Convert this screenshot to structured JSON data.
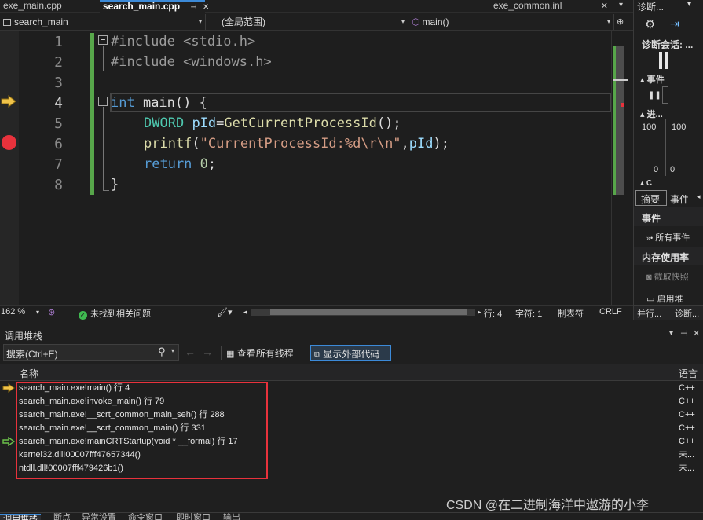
{
  "tabs": [
    {
      "label": "exe_main.cpp"
    },
    {
      "label": "search_main.cpp",
      "pin": "⊣",
      "close": "✕"
    },
    {
      "label": "exe_common.inl",
      "close": "✕"
    }
  ],
  "nav": {
    "project": "search_main",
    "scope": "(全局范围)",
    "function": "main()"
  },
  "code_lines": [
    {
      "num": "1",
      "text": "#include <stdio.h>"
    },
    {
      "num": "2",
      "text": "#include <windows.h>"
    },
    {
      "num": "3",
      "text": ""
    },
    {
      "num": "4",
      "kw": "int",
      "rest": " main() {"
    },
    {
      "num": "5",
      "ty": "DWORD",
      "var": "pId",
      "eq": "=",
      "fn": "GetCurrentProcessId",
      "tail": "();"
    },
    {
      "num": "6",
      "fn": "printf",
      "open": "(",
      "str": "\"CurrentProcessId:%d\\r\\n\"",
      "comma": ",",
      "var": "pId",
      "tail": ");"
    },
    {
      "num": "7",
      "kw": "return",
      "num_lit": "0",
      "tail": ";"
    },
    {
      "num": "8",
      "text": "}"
    }
  ],
  "editor_status": {
    "zoom": "162 %",
    "issues": "未找到相关问题",
    "row": "行: 4",
    "col": "字符: 1",
    "tabs": "制表符",
    "eol": "CRLF"
  },
  "right_panel": {
    "title": "诊断...",
    "session": "诊断会话: ...",
    "events_hdr": "事件",
    "process_hdr": "进...",
    "val_top_left": "100",
    "val_top_right": "100",
    "val_bot_left": "0",
    "val_bot_right": "0",
    "c_label": "C",
    "tab_summary": "摘要",
    "tab_events": "事件",
    "events_section": "事件",
    "all_events": "所有事件",
    "memory_section": "内存使用率",
    "snapshot": "截取快照",
    "enable_heap": "启用堆",
    "bottom_tab1": "并行...",
    "bottom_tab2": "诊断..."
  },
  "callstack": {
    "title": "调用堆栈",
    "search_placeholder": "搜索(Ctrl+E)",
    "view_threads": "查看所有线程",
    "show_external": "显示外部代码",
    "col_name": "名称",
    "col_lang": "语言",
    "rows": [
      {
        "name": "search_main.exe!main() 行 4",
        "lang": "C++"
      },
      {
        "name": "search_main.exe!invoke_main() 行 79",
        "lang": "C++"
      },
      {
        "name": "search_main.exe!__scrt_common_main_seh() 行 288",
        "lang": "C++"
      },
      {
        "name": "search_main.exe!__scrt_common_main() 行 331",
        "lang": "C++"
      },
      {
        "name": "search_main.exe!mainCRTStartup(void * __formal) 行 17",
        "lang": "C++"
      },
      {
        "name": "kernel32.dll!00007fff47657344()",
        "lang": "未..."
      },
      {
        "name": "ntdll.dll!00007fff479426b1()",
        "lang": "未..."
      }
    ]
  },
  "bottom_tabs": [
    "调用堆栈",
    "断点",
    "异常设置",
    "命令窗口",
    "即时窗口",
    "输出"
  ],
  "watermark": "CSDN @在二进制海洋中遨游的小李",
  "colors": {
    "accent": "#3c8ad8",
    "breakpoint": "#e8323c",
    "current_line_arrow": "#f0c34a",
    "change_bar": "#57a64a"
  }
}
